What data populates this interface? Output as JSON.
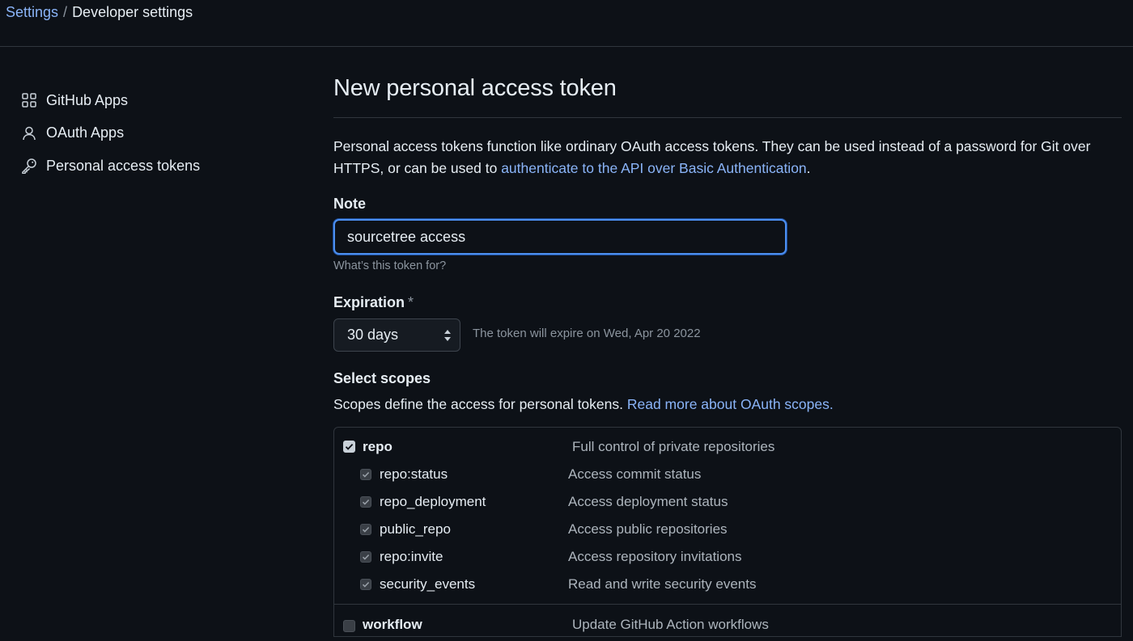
{
  "breadcrumb": {
    "settings": "Settings",
    "separator": "/",
    "current": "Developer settings"
  },
  "sidebar": {
    "items": [
      {
        "label": "GitHub Apps",
        "icon": "apps-grid-icon"
      },
      {
        "label": "OAuth Apps",
        "icon": "person-icon"
      },
      {
        "label": "Personal access tokens",
        "icon": "key-icon"
      }
    ]
  },
  "page": {
    "title": "New personal access token",
    "intro_text": "Personal access tokens function like ordinary OAuth access tokens. They can be used instead of a password for Git over HTTPS, or can be used to ",
    "intro_link": "authenticate to the API over Basic Authentication",
    "intro_end": "."
  },
  "note": {
    "label": "Note",
    "value": "sourcetree access",
    "hint": "What’s this token for?"
  },
  "expiration": {
    "label": "Expiration",
    "required_mark": "*",
    "selected": "30 days",
    "info": "The token will expire on Wed, Apr 20 2022"
  },
  "scopes": {
    "heading": "Select scopes",
    "description": "Scopes define the access for personal tokens. ",
    "description_link": "Read more about OAuth scopes.",
    "rows": [
      {
        "name": "repo",
        "desc": "Full control of private repositories",
        "checked": true,
        "level": "parent"
      },
      {
        "name": "repo:status",
        "desc": "Access commit status",
        "checked": true,
        "level": "child"
      },
      {
        "name": "repo_deployment",
        "desc": "Access deployment status",
        "checked": true,
        "level": "child"
      },
      {
        "name": "public_repo",
        "desc": "Access public repositories",
        "checked": true,
        "level": "child"
      },
      {
        "name": "repo:invite",
        "desc": "Access repository invitations",
        "checked": true,
        "level": "child"
      },
      {
        "name": "security_events",
        "desc": "Read and write security events",
        "checked": true,
        "level": "child"
      },
      {
        "name": "workflow",
        "desc": "Update GitHub Action workflows",
        "checked": false,
        "level": "parent"
      }
    ]
  },
  "colors": {
    "background": "#0d1117",
    "link": "#8ab4f8",
    "focus_border": "#4c8ff0",
    "border": "#30363d"
  }
}
